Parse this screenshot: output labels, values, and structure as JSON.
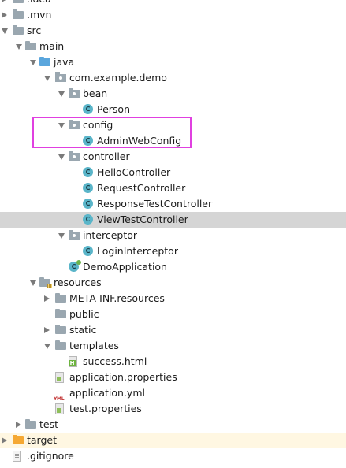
{
  "colors": {
    "selection": "#d5d5d5",
    "highlight": "#e040e0",
    "target_folder": "#f5a833",
    "source_folder": "#5aa6dd"
  },
  "tree": [
    {
      "label": ".idea",
      "depth": 0,
      "arrow": "closed",
      "icon": "folder-icon"
    },
    {
      "label": ".mvn",
      "depth": 0,
      "arrow": "closed",
      "icon": "folder-icon"
    },
    {
      "label": "src",
      "depth": 0,
      "arrow": "open",
      "icon": "folder-icon"
    },
    {
      "label": "main",
      "depth": 1,
      "arrow": "open",
      "icon": "folder-icon"
    },
    {
      "label": "java",
      "depth": 2,
      "arrow": "open",
      "icon": "source-folder-icon"
    },
    {
      "label": "com.example.demo",
      "depth": 3,
      "arrow": "open",
      "icon": "package-icon"
    },
    {
      "label": "bean",
      "depth": 4,
      "arrow": "open",
      "icon": "package-icon"
    },
    {
      "label": "Person",
      "depth": 5,
      "arrow": "none",
      "icon": "java-class-icon"
    },
    {
      "label": "config",
      "depth": 4,
      "arrow": "open",
      "icon": "package-icon"
    },
    {
      "label": "AdminWebConfig",
      "depth": 5,
      "arrow": "none",
      "icon": "java-class-icon"
    },
    {
      "label": "controller",
      "depth": 4,
      "arrow": "open",
      "icon": "package-icon"
    },
    {
      "label": "HelloController",
      "depth": 5,
      "arrow": "none",
      "icon": "java-class-icon"
    },
    {
      "label": "RequestController",
      "depth": 5,
      "arrow": "none",
      "icon": "java-class-icon"
    },
    {
      "label": "ResponseTestController",
      "depth": 5,
      "arrow": "none",
      "icon": "java-class-icon"
    },
    {
      "label": "ViewTestController",
      "depth": 5,
      "arrow": "none",
      "icon": "java-class-icon",
      "selected": true
    },
    {
      "label": "interceptor",
      "depth": 4,
      "arrow": "open",
      "icon": "package-icon"
    },
    {
      "label": "LoginInterceptor",
      "depth": 5,
      "arrow": "none",
      "icon": "java-class-icon"
    },
    {
      "label": "DemoApplication",
      "depth": 4,
      "arrow": "none",
      "icon": "spring-boot-class-icon"
    },
    {
      "label": "resources",
      "depth": 2,
      "arrow": "open",
      "icon": "resources-folder-icon"
    },
    {
      "label": "META-INF.resources",
      "depth": 3,
      "arrow": "closed",
      "icon": "folder-icon"
    },
    {
      "label": "public",
      "depth": 3,
      "arrow": "none",
      "icon": "folder-icon"
    },
    {
      "label": "static",
      "depth": 3,
      "arrow": "closed",
      "icon": "folder-icon"
    },
    {
      "label": "templates",
      "depth": 3,
      "arrow": "open",
      "icon": "folder-icon"
    },
    {
      "label": "success.html",
      "depth": 4,
      "arrow": "none",
      "icon": "html-file-icon"
    },
    {
      "label": "application.properties",
      "depth": 3,
      "arrow": "none",
      "icon": "properties-file-icon"
    },
    {
      "label": "application.yml",
      "depth": 3,
      "arrow": "none",
      "icon": "yml-file-icon"
    },
    {
      "label": "test.properties",
      "depth": 3,
      "arrow": "none",
      "icon": "properties-file-icon"
    },
    {
      "label": "test",
      "depth": 1,
      "arrow": "closed",
      "icon": "folder-icon"
    },
    {
      "label": "target",
      "depth": 0,
      "arrow": "closed",
      "icon": "target-folder-icon",
      "target": true
    },
    {
      "label": ".gitignore",
      "depth": 0,
      "arrow": "none",
      "icon": "gitignore-file-icon"
    }
  ]
}
